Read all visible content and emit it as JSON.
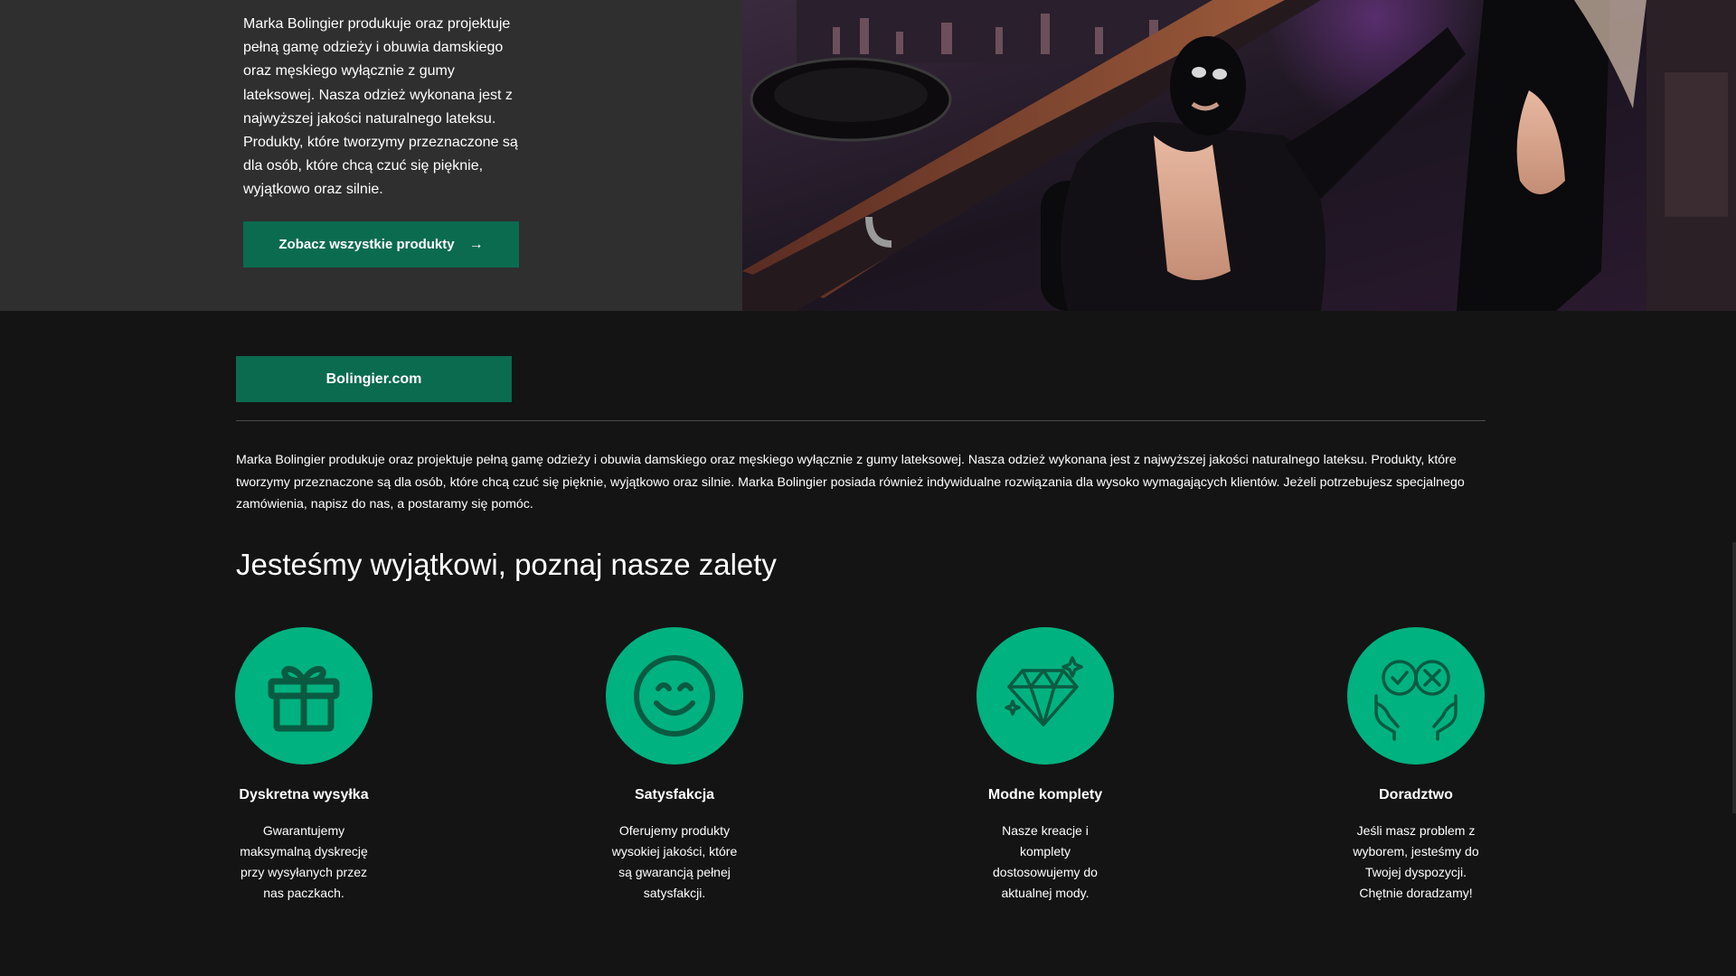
{
  "hero": {
    "text": "Marka Bolingier produkuje oraz projektuje pełną gamę odzieży i obuwia damskiego oraz męskiego wyłącznie z gumy lateksowej. Nasza odzież wykonana jest z najwyższej jakości naturalnego lateksu. Produkty, które tworzymy przeznaczone są dla osób, które chcą czuć się pięknie, wyjątkowo oraz silnie.",
    "button_label": "Zobacz wszystkie produkty",
    "button_arrow": "→"
  },
  "brand": {
    "button_label": "Bolingier.com",
    "description": "Marka Bolingier produkuje oraz projektuje pełną gamę odzieży i obuwia damskiego oraz męskiego wyłącznie z gumy lateksowej.  Nasza odzież wykonana jest z najwyższej jakości naturalnego lateksu. Produkty, które tworzymy przeznaczone są dla osób, które chcą czuć się pięknie, wyjątkowo oraz silnie. Marka Bolingier posiada również indywidualne rozwiązania dla wysoko wymagających klientów. Jeżeli potrzebujesz specjalnego zamówienia, napisz do nas, a postaramy się pomóc."
  },
  "advantages": {
    "heading": "Jesteśmy wyjątkowi, poznaj nasze zalety",
    "items": [
      {
        "icon": "gift-icon",
        "title": "Dyskretna wysyłka",
        "description": "Gwarantujemy maksymalną dyskrecję przy wysyłanych przez nas paczkach."
      },
      {
        "icon": "smile-icon",
        "title": "Satysfakcja",
        "description": "Oferujemy produkty wysokiej jakości, które są gwarancją pełnej satysfakcji."
      },
      {
        "icon": "diamond-icon",
        "title": "Modne komplety",
        "description": "Nasze kreacje i komplety dostosowujemy do aktualnej mody."
      },
      {
        "icon": "advice-hands-icon",
        "title": "Doradztwo",
        "description": "Jeśli masz problem z wyborem, jesteśmy do Twojej dyspozycji. Chętnie doradzamy!"
      }
    ]
  },
  "colors": {
    "accent_dark": "#0b6b4f",
    "accent_circle": "#00b27f",
    "icon_stroke": "#0a5a42",
    "hero_left_bg": "#2f2f2f",
    "page_bg": "#141414"
  }
}
